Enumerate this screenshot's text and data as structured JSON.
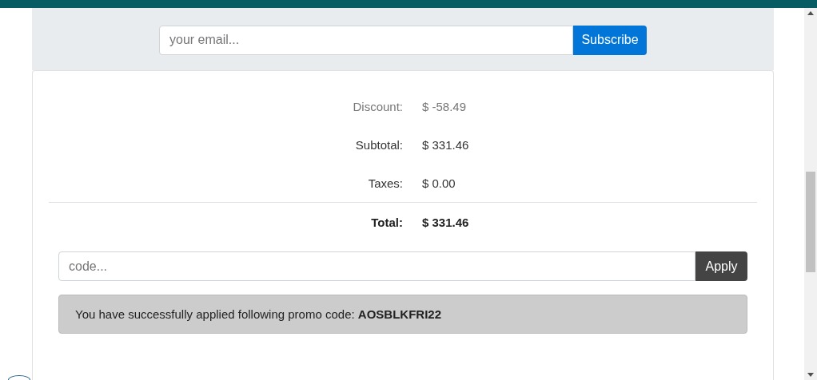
{
  "subscribe": {
    "placeholder": "your email...",
    "button": "Subscribe"
  },
  "summary": [
    {
      "label": "Discount:",
      "value": "$ -58.49",
      "kind": "discount"
    },
    {
      "label": "Subtotal:",
      "value": "$ 331.46",
      "kind": "normal"
    },
    {
      "label": "Taxes:",
      "value": "$ 0.00",
      "kind": "normal"
    },
    {
      "label": "Total:",
      "value": "$ 331.46",
      "kind": "total"
    }
  ],
  "promo": {
    "placeholder": "code...",
    "button": "Apply"
  },
  "alert": {
    "text": "You have successfully applied following promo code: **AOSBLKFRI22**"
  }
}
